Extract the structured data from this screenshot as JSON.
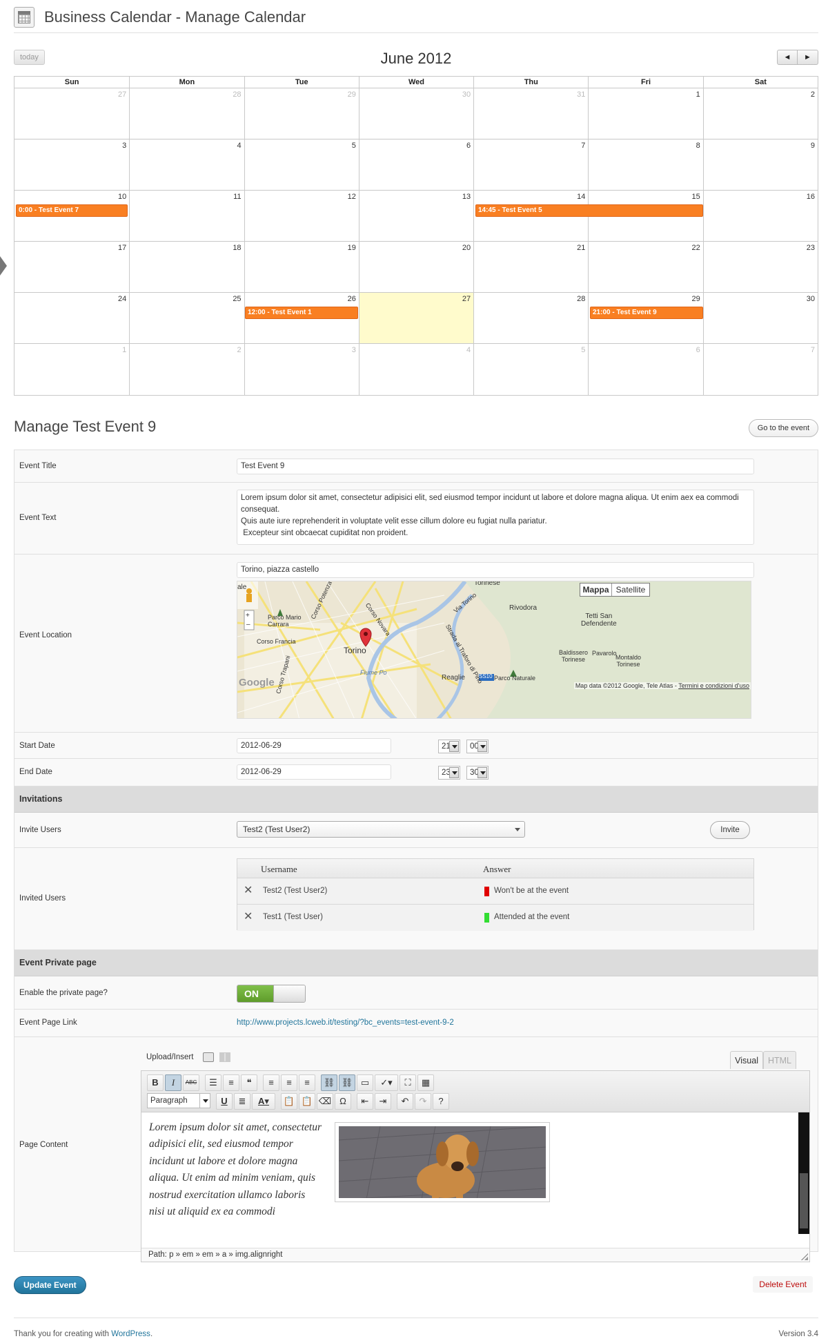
{
  "header": {
    "title": "Business Calendar - Manage Calendar"
  },
  "calendar": {
    "today_label": "today",
    "month_title": "June 2012",
    "prev_label": "◄",
    "next_label": "►",
    "weekdays": [
      "Sun",
      "Mon",
      "Tue",
      "Wed",
      "Thu",
      "Fri",
      "Sat"
    ],
    "weeks": [
      [
        "27",
        "28",
        "29",
        "30",
        "31",
        "1",
        "2"
      ],
      [
        "3",
        "4",
        "5",
        "6",
        "7",
        "8",
        "9"
      ],
      [
        "10",
        "11",
        "12",
        "13",
        "14",
        "15",
        "16"
      ],
      [
        "17",
        "18",
        "19",
        "20",
        "21",
        "22",
        "23"
      ],
      [
        "24",
        "25",
        "26",
        "27",
        "28",
        "29",
        "30"
      ],
      [
        "1",
        "2",
        "3",
        "4",
        "5",
        "6",
        "7"
      ]
    ],
    "events": {
      "e7": "0:00 - Test Event 7",
      "e5": "14:45 - Test Event 5",
      "e1": "12:00 - Test Event 1",
      "e9": "21:00 - Test Event 9"
    },
    "event_color": "#f97f22",
    "today_color": "#fffbcc"
  },
  "manage": {
    "title": "Manage Test Event 9",
    "go_button": "Go to the event"
  },
  "form": {
    "event_title_label": "Event Title",
    "event_title_value": "Test Event 9",
    "event_text_label": "Event Text",
    "event_text_value": "Lorem ipsum dolor sit amet, consectetur adipisici elit, sed eiusmod tempor incidunt ut labore et dolore magna aliqua. Ut enim aex ea commodi consequat.\nQuis aute iure reprehenderit in voluptate velit esse cillum dolore eu fugiat nulla pariatur.\n Excepteur sint obcaecat cupiditat non proident.",
    "location_label": "Event Location",
    "location_value": "Torino, piazza castello",
    "start_label": "Start Date",
    "start_date": "2012-06-29",
    "start_hour": "21",
    "start_min": "00",
    "end_label": "End Date",
    "end_date": "2012-06-29",
    "end_hour": "23",
    "end_min": "30"
  },
  "map": {
    "type_mappa": "Mappa",
    "type_satellite": "Satellite",
    "city_label": "Torino",
    "places": {
      "torinese": "Torinese",
      "rivodora": "Rivodora",
      "tetti": "Tetti San\nDefendente",
      "parco": "Parco Mario\nCarrara",
      "corso_francia": "Corso Francia",
      "corso_potenza": "Corso Potenza",
      "corso_novara": "Corso Novara",
      "via_torino": "Via Torino",
      "strada": "Strada al Traforo di Pino",
      "baldissero": "Baldissero\nTorinese",
      "pavarolo": "Pavarolo",
      "montaldo": "Montaldo\nTorinese",
      "fiume": "Fiume Po",
      "reaglie": "Reaglie",
      "parco_naturale": "Parco Naturale",
      "ss10": "SS10",
      "corso_trapani": "Corso Trapani",
      "ale": "ale"
    },
    "attribution": "Map data ©2012 Google, Tele Atlas - ",
    "terms": "Termini e condizioni d'uso",
    "google": "Google"
  },
  "invitations": {
    "section_title": "Invitations",
    "invite_label": "Invite Users",
    "select_value": "Test2 (Test User2)",
    "invite_button": "Invite",
    "invited_label": "Invited Users",
    "col_username": "Username",
    "col_answer": "Answer",
    "rows": [
      {
        "name": "Test2 (Test User2)",
        "answer": "Won't be at the event",
        "color": "#e00000"
      },
      {
        "name": "Test1 (Test User)",
        "answer": "Attended at the event",
        "color": "#33dd33"
      }
    ]
  },
  "private_page": {
    "section_title": "Event Private page",
    "enable_label": "Enable the private page?",
    "toggle_on": "ON",
    "link_label": "Event Page Link",
    "link_value": "http://www.projects.lcweb.it/testing/?bc_events=test-event-9-2",
    "content_label": "Page Content"
  },
  "editor": {
    "upload_label": "Upload/Insert",
    "tab_visual": "Visual",
    "tab_html": "HTML",
    "paragraph": "Paragraph",
    "body_text": "Lorem ipsum dolor sit amet, consectetur adipisici elit, sed eiusmod tempor incidunt ut labore et dolore magna aliqua.\nUt enim ad minim veniam, quis nostrud exercitation ullamco laboris nisi ut aliquid ex ea commodi",
    "path_label": "Path: ",
    "path": [
      "p",
      "em",
      "em",
      "a",
      "img.alignright"
    ]
  },
  "actions": {
    "update": "Update Event",
    "delete": "Delete Event"
  },
  "footer": {
    "thanks": "Thank you for creating with ",
    "wordpress": "WordPress",
    "period": ".",
    "version": "Version 3.4"
  }
}
